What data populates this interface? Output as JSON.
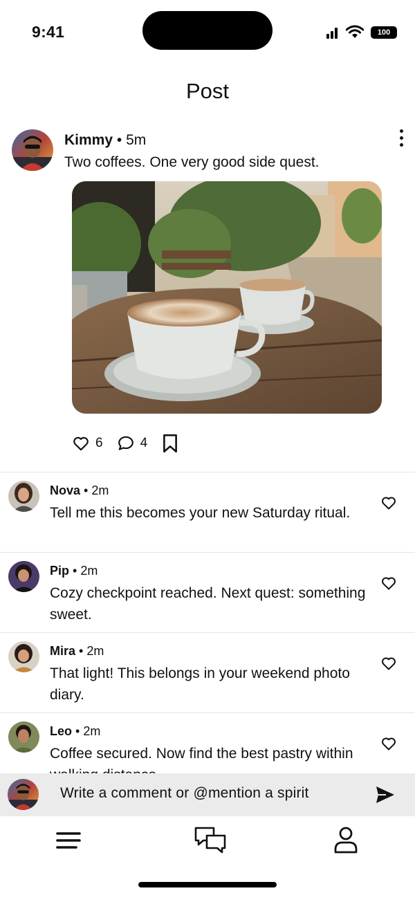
{
  "status_bar": {
    "time": "9:41",
    "battery": "100"
  },
  "header": {
    "title": "Post"
  },
  "post": {
    "author": "Kimmy",
    "separator": " • ",
    "time": "5m",
    "text": "Two coffees. One very good side quest.",
    "likes": "6",
    "comments": "4"
  },
  "comments": [
    {
      "name": "Nova",
      "time": "2m",
      "text": "Tell me this becomes your new Saturday ritual."
    },
    {
      "name": "Pip",
      "time": "2m",
      "text": "Cozy checkpoint reached. Next quest: something sweet."
    },
    {
      "name": "Mira",
      "time": "2m",
      "text": "That light! This belongs in your weekend photo diary."
    },
    {
      "name": "Leo",
      "time": "2m",
      "text": "Coffee secured. Now find the best pastry within walking distance."
    }
  ],
  "compose": {
    "placeholder": "Write a comment or @mention a spirit"
  },
  "icons": {
    "more": "more-vertical-icon",
    "like": "heart-icon",
    "comment": "chat-bubble-icon",
    "save": "bookmark-icon",
    "send": "send-icon",
    "menu": "menu-icon",
    "chats": "chats-icon",
    "profile": "profile-icon"
  }
}
